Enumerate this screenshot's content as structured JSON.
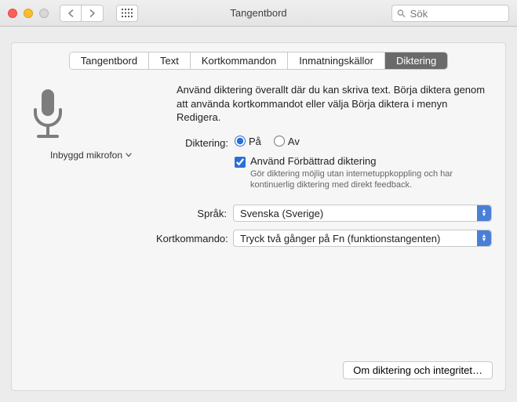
{
  "window": {
    "title": "Tangentbord"
  },
  "search": {
    "placeholder": "Sök"
  },
  "tabs": [
    "Tangentbord",
    "Text",
    "Kortkommandon",
    "Inmatningskällor",
    "Diktering"
  ],
  "active_tab_index": 4,
  "microphone": {
    "label": "Inbyggd mikrofon"
  },
  "intro": "Använd diktering överallt där du kan skriva text. Börja diktera genom att använda kortkommandot eller välja Börja diktera i menyn Redigera.",
  "dictation": {
    "label": "Diktering:",
    "on": "På",
    "off": "Av",
    "value": "on"
  },
  "enhanced": {
    "label": "Använd Förbättrad diktering",
    "description": "Gör diktering möjlig utan internetuppkoppling och har kontinuerlig diktering med direkt feedback.",
    "checked": true
  },
  "language": {
    "label": "Språk:",
    "value": "Svenska (Sverige)"
  },
  "shortcut": {
    "label": "Kortkommando:",
    "value": "Tryck två gånger på Fn (funktionstangenten)"
  },
  "footer": {
    "about": "Om diktering och integritet…"
  }
}
